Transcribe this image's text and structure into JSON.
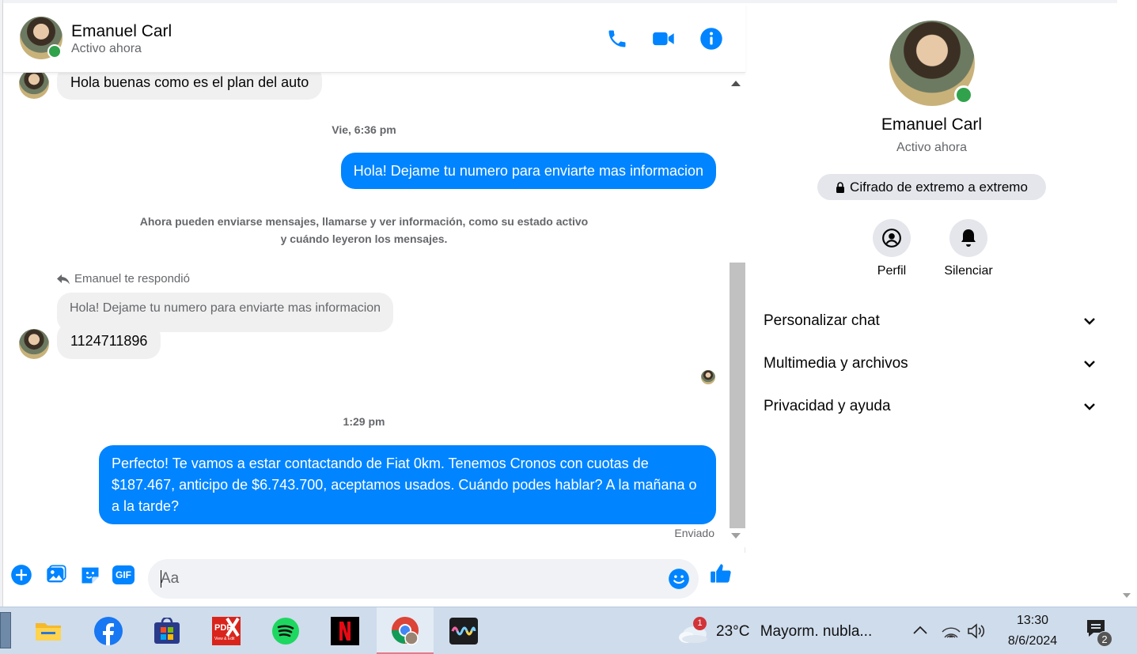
{
  "contact": {
    "name": "Emanuel Carl",
    "status": "Activo ahora"
  },
  "messages": {
    "first_incoming": "Hola buenas como es el plan del auto",
    "time_1": "Vie, 6:36 pm",
    "out_1": "Hola! Dejame tu numero para enviarte mas informacion",
    "system_line_1": "Ahora pueden enviarse mensajes, llamarse y ver información, como su estado activo",
    "system_line_2": "y cuándo leyeron los mensajes.",
    "reply_label": "Emanuel te respondió",
    "reply_quote": "Hola! Dejame tu numero para enviarte mas informacion",
    "in_number": "1124711896",
    "time_2": "1:29 pm",
    "out_2": "Perfecto! Te vamos a estar contactando de Fiat 0km. Tenemos Cronos con cuotas de $187.467, anticipo de $6.743.700, aceptamos usados. Cuándo podes hablar? A la mañana o a la tarde?",
    "sent_status": "Enviado"
  },
  "composer": {
    "placeholder": "Aa",
    "gif_label": "GIF"
  },
  "panel": {
    "encryption": "Cifrado de extremo a extremo",
    "profile_label": "Perfil",
    "mute_label": "Silenciar",
    "sections": [
      "Personalizar chat",
      "Multimedia y archivos",
      "Privacidad y ayuda"
    ]
  },
  "taskbar": {
    "weather_temp": "23°C",
    "weather_desc": "Mayorm. nubla...",
    "weather_badge": "1",
    "time": "13:30",
    "date": "8/6/2024",
    "notif_count": "2",
    "pdf_label": "PDF",
    "pdf_sub": "View & Edit"
  },
  "colors": {
    "accent": "#0084ff",
    "online": "#31a24c"
  },
  "icons": [
    "phone-icon",
    "video-icon",
    "info-icon",
    "plus-icon",
    "image-icon",
    "sticker-icon",
    "gif-icon",
    "emoji-icon",
    "like-icon",
    "lock-icon",
    "profile-icon",
    "bell-icon",
    "chevron-down-icon",
    "reply-icon"
  ]
}
